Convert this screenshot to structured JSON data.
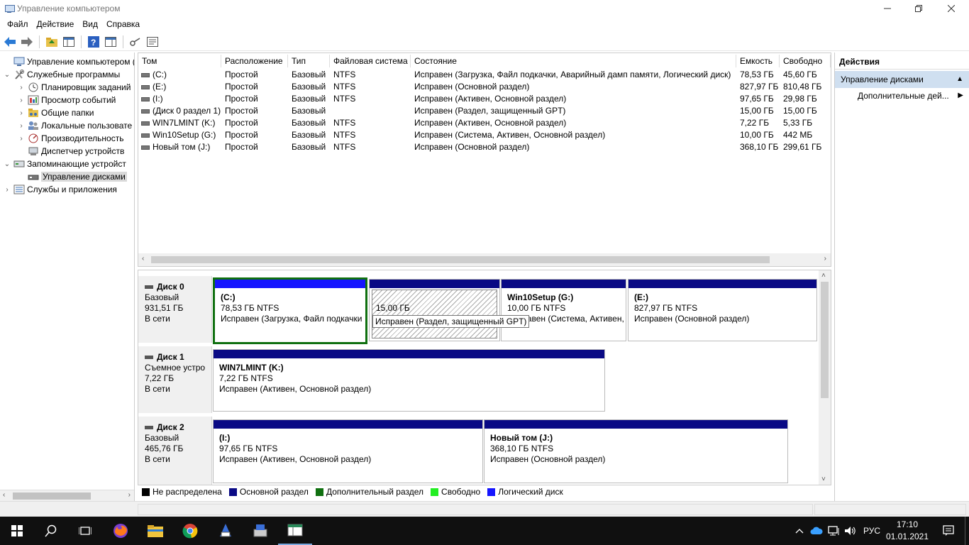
{
  "window": {
    "title": "Управление компьютером"
  },
  "menu": [
    "Файл",
    "Действие",
    "Вид",
    "Справка"
  ],
  "tree": {
    "items": [
      {
        "label": "Управление компьютером (л",
        "level": 0,
        "exp": ""
      },
      {
        "label": "Служебные программы",
        "level": 1,
        "exp": "⌄"
      },
      {
        "label": "Планировщик заданий",
        "level": 2,
        "exp": "›"
      },
      {
        "label": "Просмотр событий",
        "level": 2,
        "exp": "›"
      },
      {
        "label": "Общие папки",
        "level": 2,
        "exp": "›"
      },
      {
        "label": "Локальные пользовате",
        "level": 2,
        "exp": "›"
      },
      {
        "label": "Производительность",
        "level": 2,
        "exp": "›"
      },
      {
        "label": "Диспетчер устройств",
        "level": 2,
        "exp": ""
      },
      {
        "label": "Запоминающие устройст",
        "level": 1,
        "exp": "⌄"
      },
      {
        "label": "Управление дисками",
        "level": 2,
        "exp": "",
        "selected": true
      },
      {
        "label": "Службы и приложения",
        "level": 1,
        "exp": "›"
      }
    ]
  },
  "volumes": {
    "columns": [
      "Том",
      "Расположение",
      "Тип",
      "Файловая система",
      "Состояние",
      "Емкость",
      "Свободно"
    ],
    "rows": [
      {
        "tom": "(C:)",
        "loc": "Простой",
        "type": "Базовый",
        "fs": "NTFS",
        "state": "Исправен (Загрузка, Файл подкачки, Аварийный дамп памяти, Логический диск)",
        "cap": "78,53 ГБ",
        "free": "45,60 ГБ"
      },
      {
        "tom": "(E:)",
        "loc": "Простой",
        "type": "Базовый",
        "fs": "NTFS",
        "state": "Исправен (Основной раздел)",
        "cap": "827,97 ГБ",
        "free": "810,48 ГБ"
      },
      {
        "tom": "(I:)",
        "loc": "Простой",
        "type": "Базовый",
        "fs": "NTFS",
        "state": "Исправен (Активен, Основной раздел)",
        "cap": "97,65 ГБ",
        "free": "29,98 ГБ"
      },
      {
        "tom": "(Диск 0 раздел 1)",
        "loc": "Простой",
        "type": "Базовый",
        "fs": "",
        "state": "Исправен (Раздел, защищенный GPT)",
        "cap": "15,00 ГБ",
        "free": "15,00 ГБ"
      },
      {
        "tom": "WIN7LMINT (K:)",
        "loc": "Простой",
        "type": "Базовый",
        "fs": "NTFS",
        "state": "Исправен (Активен, Основной раздел)",
        "cap": "7,22 ГБ",
        "free": "5,33 ГБ"
      },
      {
        "tom": "Win10Setup (G:)",
        "loc": "Простой",
        "type": "Базовый",
        "fs": "NTFS",
        "state": "Исправен (Система, Активен, Основной раздел)",
        "cap": "10,00 ГБ",
        "free": "442 МБ"
      },
      {
        "tom": "Новый том (J:)",
        "loc": "Простой",
        "type": "Базовый",
        "fs": "NTFS",
        "state": "Исправен (Основной раздел)",
        "cap": "368,10 ГБ",
        "free": "299,61 ГБ"
      }
    ]
  },
  "disks": [
    {
      "name": "Диск 0",
      "kind": "Базовый",
      "size": "931,51 ГБ",
      "status": "В сети",
      "parts": [
        {
          "name": "(C:)",
          "size": "78,53 ГБ NTFS",
          "state": "Исправен (Загрузка, Файл подкачки"
        },
        {
          "name": "",
          "size": "15,00 ГБ",
          "state": ""
        },
        {
          "name": "Win10Setup  (G:)",
          "size": "10,00 ГБ NTFS",
          "state": "Исправен (Система, Активен,"
        },
        {
          "name": "(E:)",
          "size": "827,97 ГБ NTFS",
          "state": "Исправен (Основной раздел)"
        }
      ]
    },
    {
      "name": "Диск 1",
      "kind": "Съемное устро",
      "size": "7,22 ГБ",
      "status": "В сети",
      "parts": [
        {
          "name": "WIN7LMINT  (K:)",
          "size": "7,22 ГБ NTFS",
          "state": "Исправен (Активен, Основной раздел)"
        }
      ]
    },
    {
      "name": "Диск 2",
      "kind": "Базовый",
      "size": "465,76 ГБ",
      "status": "В сети",
      "parts": [
        {
          "name": "(I:)",
          "size": "97,65 ГБ NTFS",
          "state": "Исправен (Активен, Основной раздел)"
        },
        {
          "name": "Новый том  (J:)",
          "size": "368,10 ГБ NTFS",
          "state": "Исправен (Основной раздел)"
        }
      ]
    }
  ],
  "tooltip": "Исправен (Раздел, защищенный GPT)",
  "legend": [
    {
      "label": "Не распределена",
      "color": "#000000"
    },
    {
      "label": "Основной раздел",
      "color": "#0a0a85"
    },
    {
      "label": "Дополнительный раздел",
      "color": "#107010"
    },
    {
      "label": "Свободно",
      "color": "#22ee22"
    },
    {
      "label": "Логический диск",
      "color": "#1515ff"
    }
  ],
  "actions": {
    "header": "Действия",
    "section": "Управление дисками",
    "more": "Дополнительные дей..."
  },
  "taskbar": {
    "lang": "РУС",
    "time": "17:10",
    "date": "01.01.2021"
  }
}
